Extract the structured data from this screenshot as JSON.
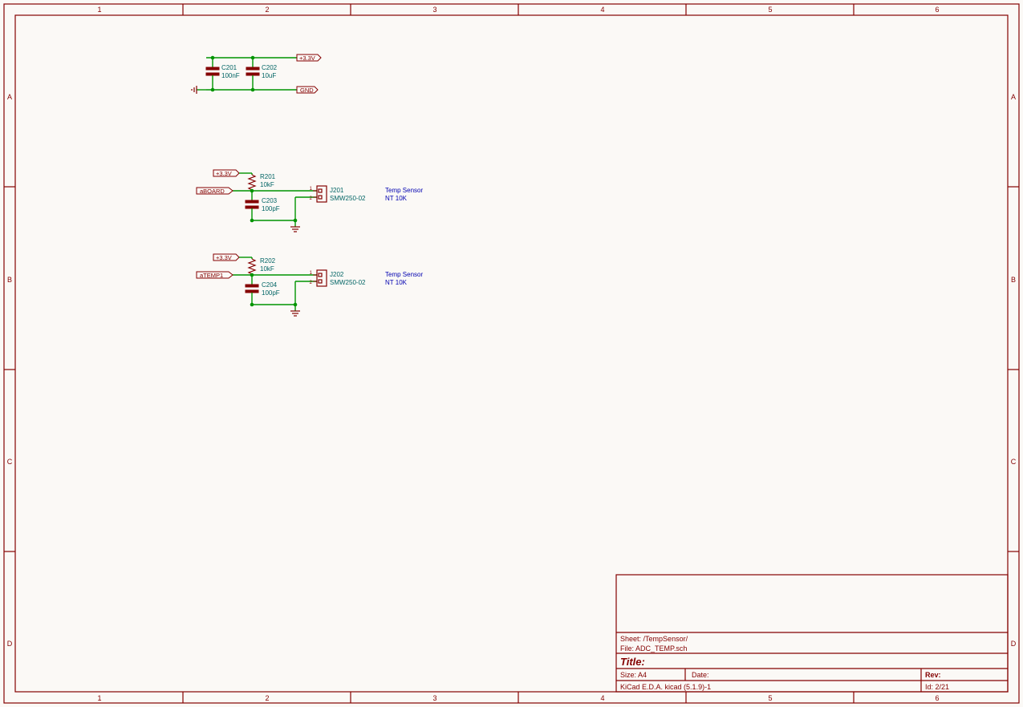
{
  "frame": {
    "cols": [
      "1",
      "2",
      "3",
      "4",
      "5",
      "6"
    ],
    "rows": [
      "A",
      "B",
      "C",
      "D"
    ]
  },
  "title_block": {
    "sheet_label": "Sheet:",
    "sheet": "/TempSensor/",
    "file_label": "File:",
    "file": "ADC_TEMP.sch",
    "title_label": "Title:",
    "title": "",
    "size_label": "Size:",
    "size": "A4",
    "date_label": "Date:",
    "date": "",
    "rev_label": "Rev:",
    "rev": "",
    "tool_label": "KiCad E.D.A.",
    "tool": "kicad (5.1.9)-1",
    "id_label": "Id:",
    "id": "2/21"
  },
  "power": {
    "v33": "+3.3V",
    "gnd": "GND"
  },
  "labels": {
    "aboard": "aBOARD",
    "atemp1": "aTEMP1"
  },
  "decoupling": {
    "c201": {
      "ref": "C201",
      "val": "100nF"
    },
    "c202": {
      "ref": "C202",
      "val": "10uF"
    }
  },
  "blocks": [
    {
      "key": "b1",
      "r": {
        "ref": "R201",
        "val": "10kF"
      },
      "c": {
        "ref": "C203",
        "val": "100pF"
      },
      "j": {
        "ref": "J201",
        "val": "SMW250-02",
        "p1": "1",
        "p2": "2"
      },
      "note1": "Temp Sensor",
      "note2": "NT 10K"
    },
    {
      "key": "b2",
      "r": {
        "ref": "R202",
        "val": "10kF"
      },
      "c": {
        "ref": "C204",
        "val": "100pF"
      },
      "j": {
        "ref": "J202",
        "val": "SMW250-02",
        "p1": "1",
        "p2": "2"
      },
      "note1": "Temp Sensor",
      "note2": "NT 10K"
    }
  ]
}
